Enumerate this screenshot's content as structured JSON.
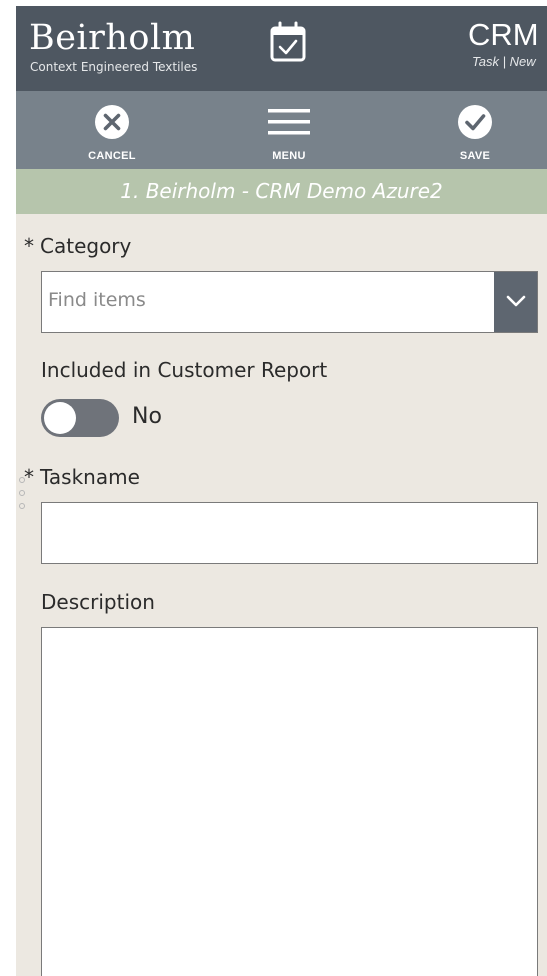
{
  "header": {
    "brand_name": "Beirholm",
    "brand_tagline": "Context Engineered Textiles",
    "app_title": "CRM",
    "app_subtitle": "Task | New"
  },
  "toolbar": {
    "cancel_label": "CANCEL",
    "menu_label": "MENU",
    "save_label": "SAVE"
  },
  "record": {
    "title": "1. Beirholm - CRM Demo Azure2"
  },
  "form": {
    "required_marker": "*",
    "category": {
      "label": "Category",
      "placeholder": "Find items"
    },
    "customer_report": {
      "label": "Included in Customer Report",
      "value": "No"
    },
    "taskname": {
      "label": "Taskname",
      "value": ""
    },
    "description": {
      "label": "Description",
      "value": ""
    }
  },
  "colors": {
    "header_bg": "#4e5761",
    "toolbar_bg": "#78828b",
    "banner_bg": "#b6c5ac",
    "page_bg": "#ece8e1"
  },
  "icons": {
    "header": "calendar-check-icon",
    "cancel": "close-circle-icon",
    "menu": "hamburger-menu-icon",
    "save": "checkmark-circle-icon",
    "dropdown": "chevron-down-icon"
  }
}
